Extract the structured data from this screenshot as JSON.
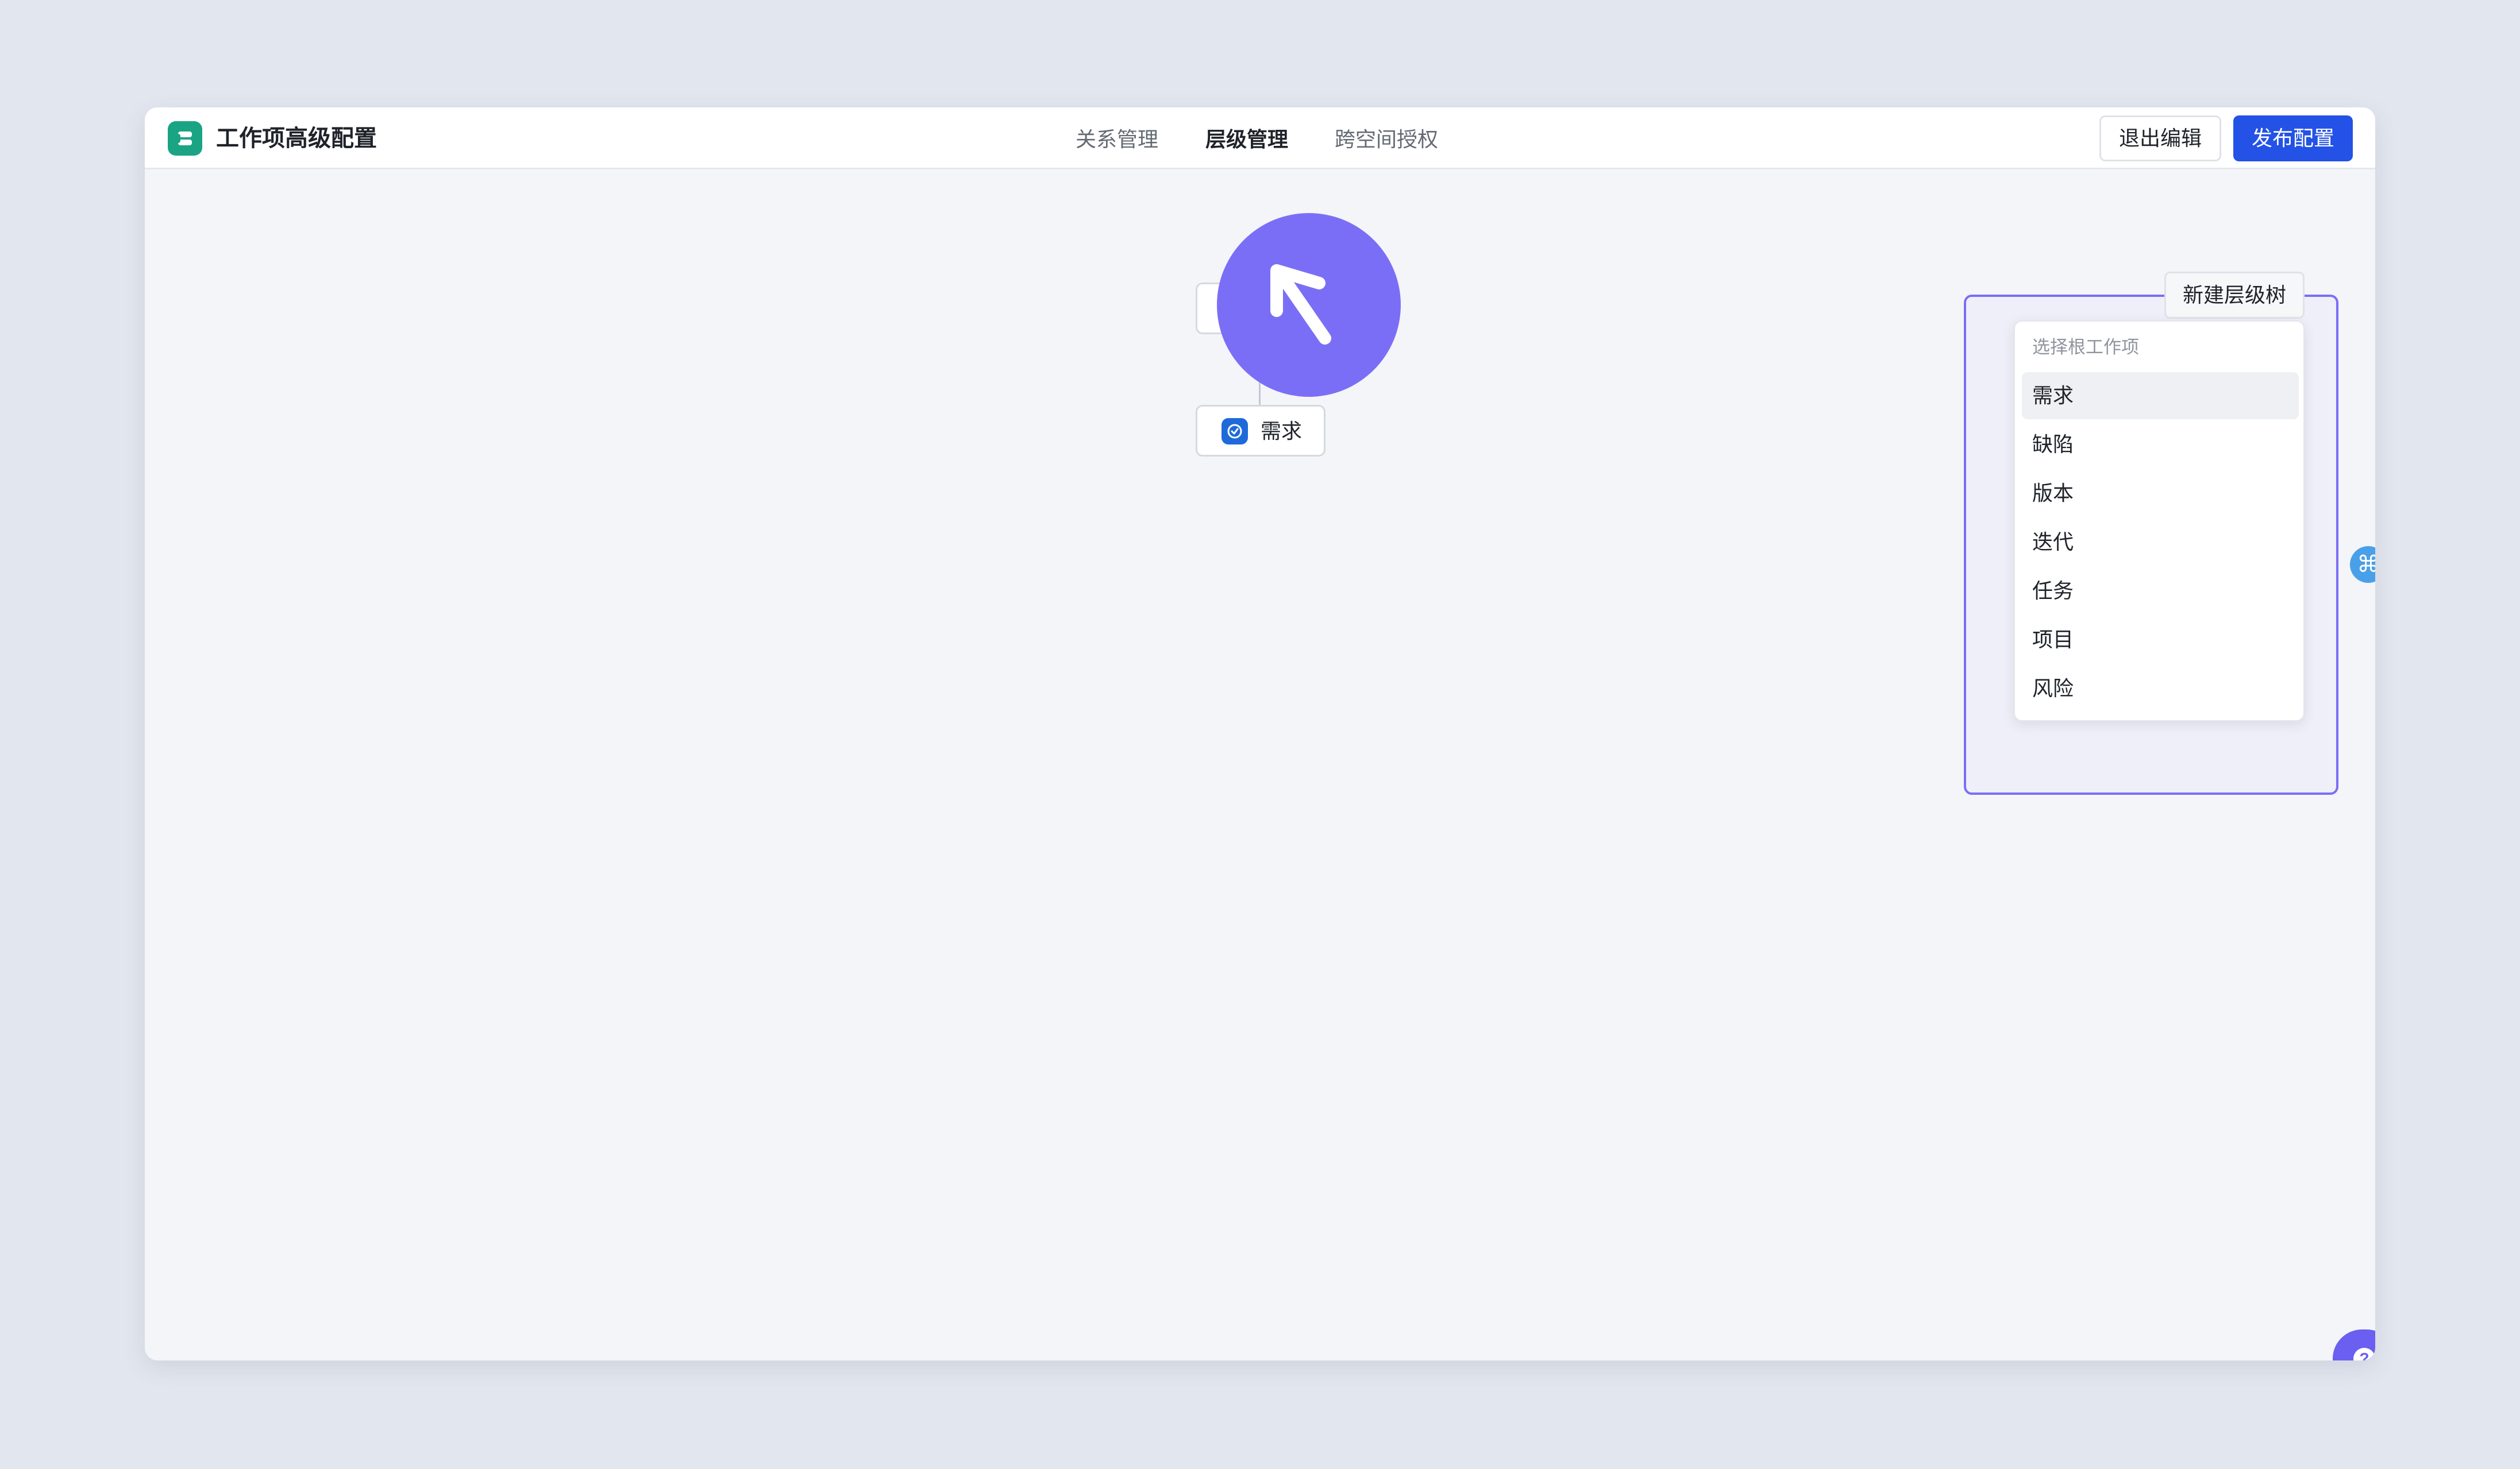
{
  "app": {
    "title": "工作项高级配置"
  },
  "tabs": [
    {
      "label": "关系管理",
      "active": false
    },
    {
      "label": "层级管理",
      "active": true
    },
    {
      "label": "跨空间授权",
      "active": false
    }
  ],
  "actions": {
    "exit_label": "退出编辑",
    "publish_label": "发布配置"
  },
  "canvas": {
    "nodes": [
      {
        "label": "",
        "icon": "bookmark-icon",
        "color": "#c23ec6"
      },
      {
        "label": "需求",
        "icon": "check-circle-icon",
        "color": "#1f6ad9"
      }
    ]
  },
  "panel": {
    "new_tree_label": "新建层级树",
    "dropdown": {
      "header": "选择根工作项",
      "options": [
        "需求",
        "缺陷",
        "版本",
        "迭代",
        "任务",
        "项目",
        "风险"
      ],
      "highlighted_index": 0
    }
  },
  "floating": {
    "side_icon": "command-icon",
    "side_glyph": "⌘",
    "help_icon": "question-icon",
    "help_glyph": "?"
  },
  "colors": {
    "primary": "#2452e6",
    "accent": "#7b6ef6",
    "brand": "#1aa483"
  }
}
